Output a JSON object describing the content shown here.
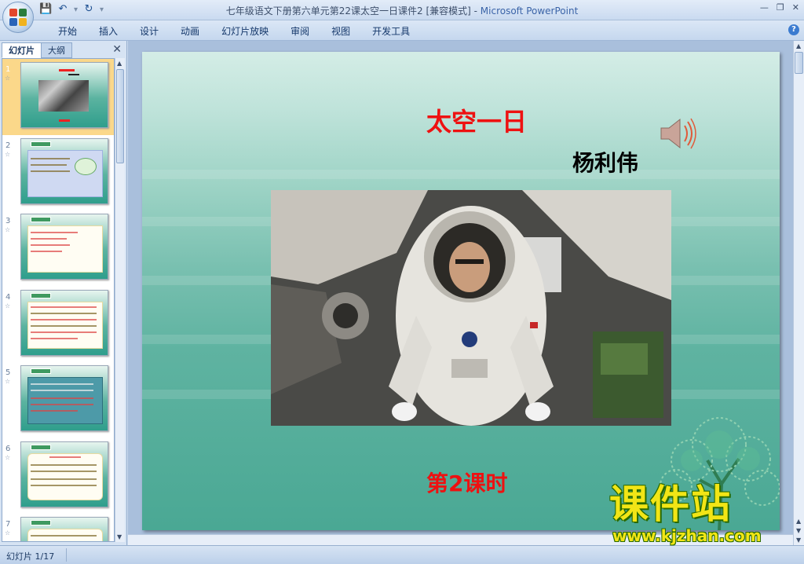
{
  "window": {
    "title": "七年级语文下册第六单元第22课太空一日课件2 [兼容模式]",
    "separator": " - ",
    "app": "Microsoft PowerPoint"
  },
  "ribbon": {
    "tabs": [
      "开始",
      "插入",
      "设计",
      "动画",
      "幻灯片放映",
      "审阅",
      "视图",
      "开发工具"
    ]
  },
  "left_pane": {
    "tab_slides": "幻灯片",
    "tab_outline": "大纲",
    "thumbnails": [
      {
        "num": "1",
        "selected": true
      },
      {
        "num": "2",
        "selected": false
      },
      {
        "num": "3",
        "selected": false
      },
      {
        "num": "4",
        "selected": false
      },
      {
        "num": "5",
        "selected": false
      },
      {
        "num": "6",
        "selected": false
      },
      {
        "num": "7",
        "selected": false
      }
    ]
  },
  "slide": {
    "title": "太空一日",
    "author": "杨利伟",
    "lesson": "第2课时",
    "speaker_icon": "speaker-icon",
    "photo": "astronaut-photo"
  },
  "status_bar": {
    "slide_indicator": "幻灯片 1/17"
  },
  "watermark": {
    "title": "课件站",
    "url": "www.kjzhan.com"
  },
  "colors": {
    "slide_title": "#ee1111",
    "slide_bg_top": "#d4ede6",
    "slide_bg_bottom": "#4aa894",
    "selection": "#fbd88a"
  }
}
